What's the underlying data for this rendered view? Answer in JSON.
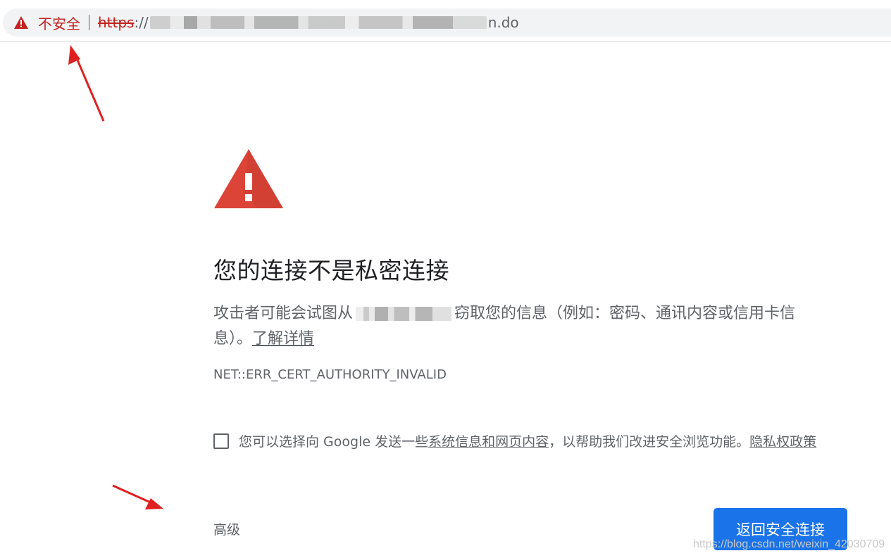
{
  "address_bar": {
    "security_label": "不安全",
    "url_scheme": "https",
    "url_separator": "://",
    "url_tail": "n.do"
  },
  "interstitial": {
    "heading": "您的连接不是私密连接",
    "description_before": "攻击者可能会试图从",
    "description_after": "窃取您的信息（例如：密码、通讯内容或信用卡信息）。",
    "learn_more": "了解详情",
    "error_code": "NET::ERR_CERT_AUTHORITY_INVALID",
    "optin_before": "您可以选择向 Google 发送一些",
    "optin_link": "系统信息和网页内容",
    "optin_after": "，以帮助我们改进安全浏览功能。",
    "privacy_link": "隐私权政策",
    "advanced_label": "高级",
    "back_button_label": "返回安全连接"
  },
  "watermark": "https://blog.csdn.net/weixin_42030709",
  "colors": {
    "danger": "#c5221f",
    "warning_icon": "#db4437",
    "primary_button": "#1a73e8",
    "annotation_arrow": "#e02020"
  }
}
